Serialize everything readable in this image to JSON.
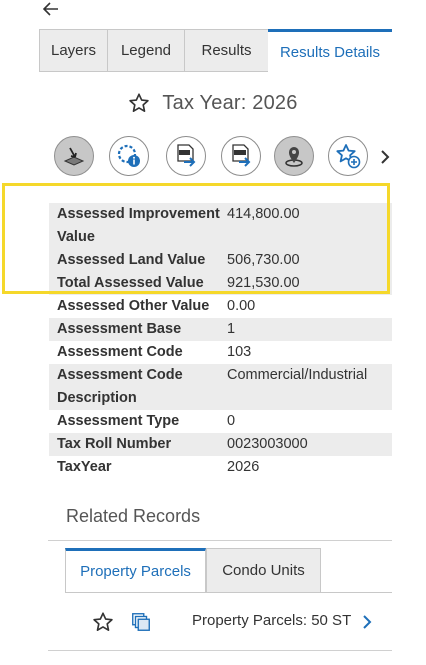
{
  "tabs": [
    {
      "label": "Layers"
    },
    {
      "label": "Legend"
    },
    {
      "label": "Results"
    },
    {
      "label": "Results Details"
    }
  ],
  "details": {
    "title": "Tax Year: 2026"
  },
  "toolbar": {
    "icons": [
      "zoom-to-icon",
      "identify-icon",
      "export-csv-icon",
      "export-xlsx-icon",
      "pin-location-icon",
      "add-favorite-icon"
    ]
  },
  "attributes": [
    {
      "key": "Assessed Improvement Value",
      "value": "414,800.00"
    },
    {
      "key": "Assessed Land Value",
      "value": "506,730.00"
    },
    {
      "key": "Total Assessed Value",
      "value": "921,530.00"
    },
    {
      "key": "Assessed Other Value",
      "value": "0.00"
    },
    {
      "key": "Assessment Base",
      "value": "1"
    },
    {
      "key": "Assessment Code",
      "value": "103"
    },
    {
      "key": "Assessment Code Description",
      "value": "Commercial/Industrial"
    },
    {
      "key": "Assessment Type",
      "value": "0"
    },
    {
      "key": "Tax Roll Number",
      "value": "0023003000"
    },
    {
      "key": "TaxYear",
      "value": "2026"
    }
  ],
  "related": {
    "title": "Related Records",
    "tabs": [
      {
        "label": "Property Parcels"
      },
      {
        "label": "Condo Units"
      }
    ],
    "record": {
      "label": "Property Parcels: 50 ST"
    }
  },
  "colors": {
    "accent": "#1e6fb9",
    "highlight": "#f5d82a",
    "shade": "#ececec"
  }
}
